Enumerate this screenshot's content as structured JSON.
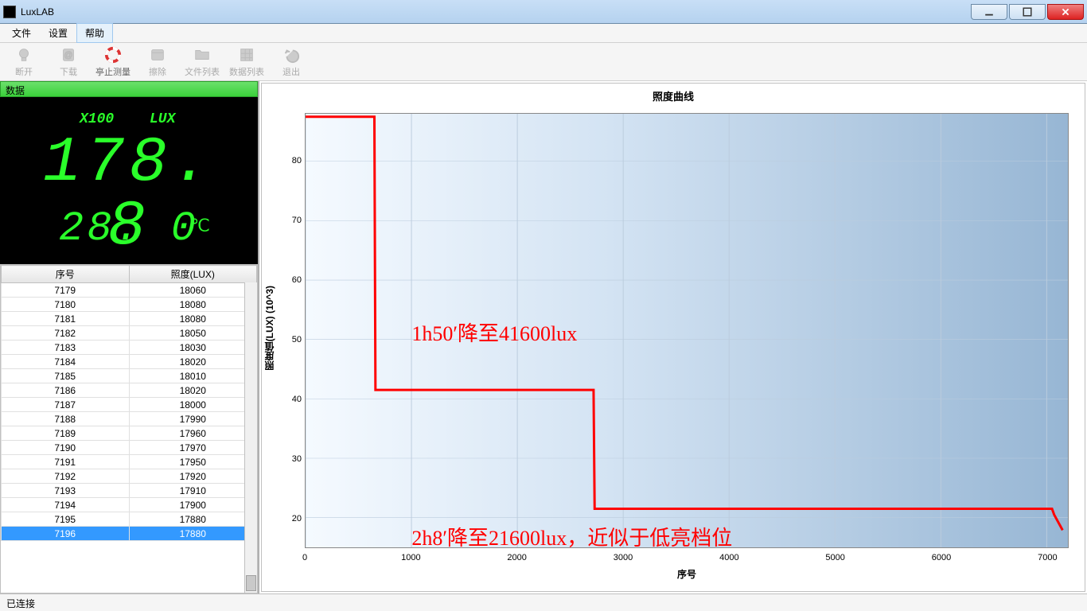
{
  "window": {
    "title": "LuxLAB"
  },
  "menu": {
    "file": "文件",
    "settings": "设置",
    "help": "帮助"
  },
  "toolbar": {
    "disconnect": "断开",
    "download": "下载",
    "stop_measure": "亭止测量",
    "erase": "擦除",
    "file_list": "文件列表",
    "data_list": "数据列表",
    "exit": "退出"
  },
  "data_panel": {
    "header": "数据",
    "scale_label": "X100",
    "lux_label": "LUX",
    "lux_value": "178. 8",
    "temp_value": "28. 0",
    "temp_unit": "℃"
  },
  "table": {
    "col_seq": "序号",
    "col_lux": "照度(LUX)",
    "rows": [
      {
        "seq": "7179",
        "lux": "18060"
      },
      {
        "seq": "7180",
        "lux": "18080"
      },
      {
        "seq": "7181",
        "lux": "18080"
      },
      {
        "seq": "7182",
        "lux": "18050"
      },
      {
        "seq": "7183",
        "lux": "18030"
      },
      {
        "seq": "7184",
        "lux": "18020"
      },
      {
        "seq": "7185",
        "lux": "18010"
      },
      {
        "seq": "7186",
        "lux": "18020"
      },
      {
        "seq": "7187",
        "lux": "18000"
      },
      {
        "seq": "7188",
        "lux": "17990"
      },
      {
        "seq": "7189",
        "lux": "17960"
      },
      {
        "seq": "7190",
        "lux": "17970"
      },
      {
        "seq": "7191",
        "lux": "17950"
      },
      {
        "seq": "7192",
        "lux": "17920"
      },
      {
        "seq": "7193",
        "lux": "17910"
      },
      {
        "seq": "7194",
        "lux": "17900"
      },
      {
        "seq": "7195",
        "lux": "17880"
      },
      {
        "seq": "7196",
        "lux": "17880"
      }
    ],
    "selected_index": 17
  },
  "chart": {
    "title": "照度曲线",
    "ylabel": "照度值(LUX) (10^3)",
    "xlabel": "序号",
    "annotation1": "1h50′降至41600lux",
    "annotation2": "2h8′降至21600lux，近似于低亮档位"
  },
  "chart_data": {
    "type": "line",
    "xlabel": "序号",
    "ylabel": "照度值(LUX) (10^3)",
    "title": "照度曲线",
    "xlim": [
      0,
      7200
    ],
    "ylim": [
      15,
      88
    ],
    "x_ticks": [
      0,
      1000,
      2000,
      3000,
      4000,
      5000,
      6000,
      7000
    ],
    "y_ticks": [
      20,
      30,
      40,
      50,
      60,
      70,
      80
    ],
    "series": [
      {
        "name": "lux",
        "x": [
          0,
          650,
          660,
          2720,
          2730,
          7050,
          7070,
          7150
        ],
        "values": [
          87.5,
          87.5,
          41.5,
          41.5,
          21.5,
          21.5,
          20.5,
          17.9
        ]
      }
    ],
    "annotations": [
      {
        "text": "1h50′降至41600lux",
        "x": 1000,
        "y": 52
      },
      {
        "text": "2h8′降至21600lux，近似于低亮档位",
        "x": 1000,
        "y": 22
      }
    ]
  },
  "status": {
    "text": "已连接"
  }
}
